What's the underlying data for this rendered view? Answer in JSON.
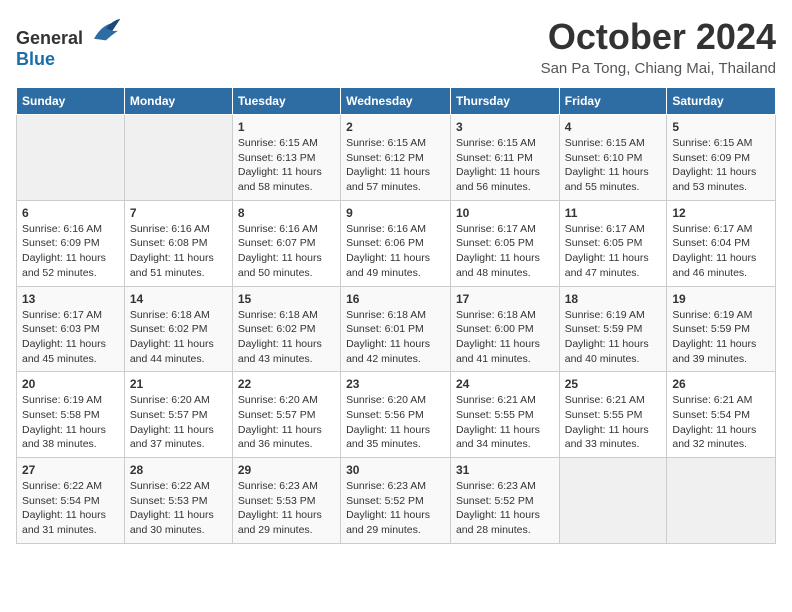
{
  "header": {
    "logo_general": "General",
    "logo_blue": "Blue",
    "month_title": "October 2024",
    "location": "San Pa Tong, Chiang Mai, Thailand"
  },
  "days_of_week": [
    "Sunday",
    "Monday",
    "Tuesday",
    "Wednesday",
    "Thursday",
    "Friday",
    "Saturday"
  ],
  "weeks": [
    [
      {
        "day": "",
        "info": ""
      },
      {
        "day": "",
        "info": ""
      },
      {
        "day": "1",
        "info": "Sunrise: 6:15 AM\nSunset: 6:13 PM\nDaylight: 11 hours and 58 minutes."
      },
      {
        "day": "2",
        "info": "Sunrise: 6:15 AM\nSunset: 6:12 PM\nDaylight: 11 hours and 57 minutes."
      },
      {
        "day": "3",
        "info": "Sunrise: 6:15 AM\nSunset: 6:11 PM\nDaylight: 11 hours and 56 minutes."
      },
      {
        "day": "4",
        "info": "Sunrise: 6:15 AM\nSunset: 6:10 PM\nDaylight: 11 hours and 55 minutes."
      },
      {
        "day": "5",
        "info": "Sunrise: 6:15 AM\nSunset: 6:09 PM\nDaylight: 11 hours and 53 minutes."
      }
    ],
    [
      {
        "day": "6",
        "info": "Sunrise: 6:16 AM\nSunset: 6:09 PM\nDaylight: 11 hours and 52 minutes."
      },
      {
        "day": "7",
        "info": "Sunrise: 6:16 AM\nSunset: 6:08 PM\nDaylight: 11 hours and 51 minutes."
      },
      {
        "day": "8",
        "info": "Sunrise: 6:16 AM\nSunset: 6:07 PM\nDaylight: 11 hours and 50 minutes."
      },
      {
        "day": "9",
        "info": "Sunrise: 6:16 AM\nSunset: 6:06 PM\nDaylight: 11 hours and 49 minutes."
      },
      {
        "day": "10",
        "info": "Sunrise: 6:17 AM\nSunset: 6:05 PM\nDaylight: 11 hours and 48 minutes."
      },
      {
        "day": "11",
        "info": "Sunrise: 6:17 AM\nSunset: 6:05 PM\nDaylight: 11 hours and 47 minutes."
      },
      {
        "day": "12",
        "info": "Sunrise: 6:17 AM\nSunset: 6:04 PM\nDaylight: 11 hours and 46 minutes."
      }
    ],
    [
      {
        "day": "13",
        "info": "Sunrise: 6:17 AM\nSunset: 6:03 PM\nDaylight: 11 hours and 45 minutes."
      },
      {
        "day": "14",
        "info": "Sunrise: 6:18 AM\nSunset: 6:02 PM\nDaylight: 11 hours and 44 minutes."
      },
      {
        "day": "15",
        "info": "Sunrise: 6:18 AM\nSunset: 6:02 PM\nDaylight: 11 hours and 43 minutes."
      },
      {
        "day": "16",
        "info": "Sunrise: 6:18 AM\nSunset: 6:01 PM\nDaylight: 11 hours and 42 minutes."
      },
      {
        "day": "17",
        "info": "Sunrise: 6:18 AM\nSunset: 6:00 PM\nDaylight: 11 hours and 41 minutes."
      },
      {
        "day": "18",
        "info": "Sunrise: 6:19 AM\nSunset: 5:59 PM\nDaylight: 11 hours and 40 minutes."
      },
      {
        "day": "19",
        "info": "Sunrise: 6:19 AM\nSunset: 5:59 PM\nDaylight: 11 hours and 39 minutes."
      }
    ],
    [
      {
        "day": "20",
        "info": "Sunrise: 6:19 AM\nSunset: 5:58 PM\nDaylight: 11 hours and 38 minutes."
      },
      {
        "day": "21",
        "info": "Sunrise: 6:20 AM\nSunset: 5:57 PM\nDaylight: 11 hours and 37 minutes."
      },
      {
        "day": "22",
        "info": "Sunrise: 6:20 AM\nSunset: 5:57 PM\nDaylight: 11 hours and 36 minutes."
      },
      {
        "day": "23",
        "info": "Sunrise: 6:20 AM\nSunset: 5:56 PM\nDaylight: 11 hours and 35 minutes."
      },
      {
        "day": "24",
        "info": "Sunrise: 6:21 AM\nSunset: 5:55 PM\nDaylight: 11 hours and 34 minutes."
      },
      {
        "day": "25",
        "info": "Sunrise: 6:21 AM\nSunset: 5:55 PM\nDaylight: 11 hours and 33 minutes."
      },
      {
        "day": "26",
        "info": "Sunrise: 6:21 AM\nSunset: 5:54 PM\nDaylight: 11 hours and 32 minutes."
      }
    ],
    [
      {
        "day": "27",
        "info": "Sunrise: 6:22 AM\nSunset: 5:54 PM\nDaylight: 11 hours and 31 minutes."
      },
      {
        "day": "28",
        "info": "Sunrise: 6:22 AM\nSunset: 5:53 PM\nDaylight: 11 hours and 30 minutes."
      },
      {
        "day": "29",
        "info": "Sunrise: 6:23 AM\nSunset: 5:53 PM\nDaylight: 11 hours and 29 minutes."
      },
      {
        "day": "30",
        "info": "Sunrise: 6:23 AM\nSunset: 5:52 PM\nDaylight: 11 hours and 29 minutes."
      },
      {
        "day": "31",
        "info": "Sunrise: 6:23 AM\nSunset: 5:52 PM\nDaylight: 11 hours and 28 minutes."
      },
      {
        "day": "",
        "info": ""
      },
      {
        "day": "",
        "info": ""
      }
    ]
  ]
}
